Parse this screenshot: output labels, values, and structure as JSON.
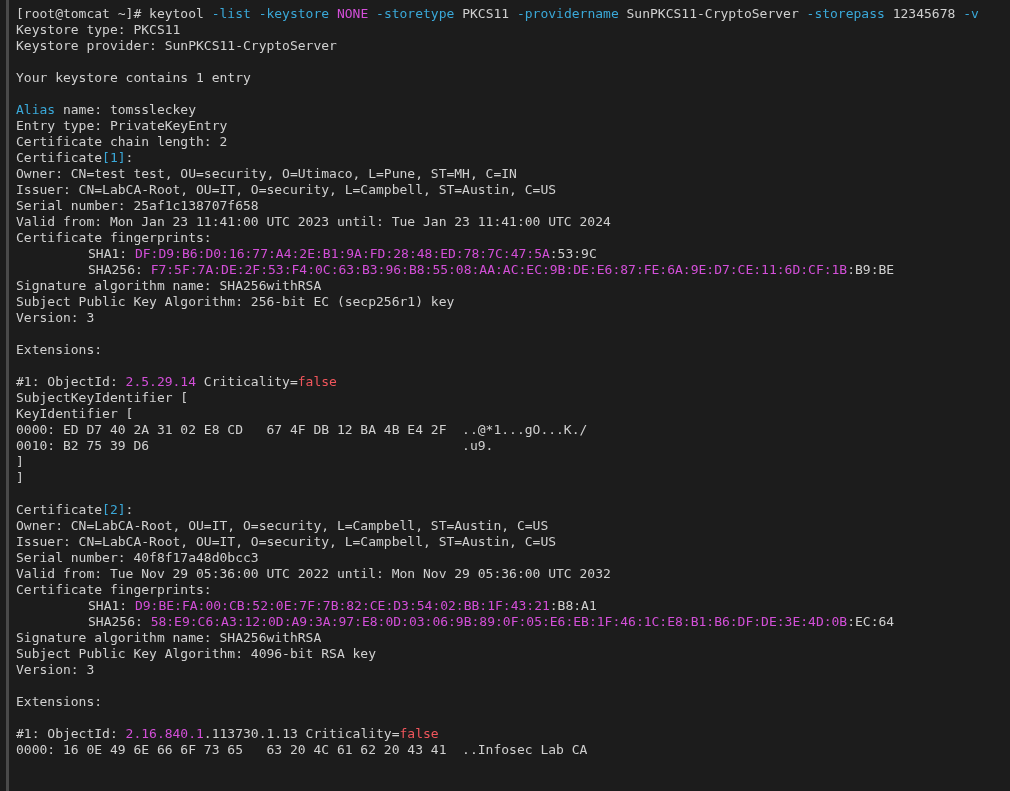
{
  "terminal": {
    "lines": [
      {
        "kind": "text",
        "segments": [
          {
            "kind": "plain",
            "text": "[root@tomcat ~]# keytool "
          },
          {
            "kind": "flag",
            "text": "-list "
          },
          {
            "kind": "flag",
            "text": "-keystore "
          },
          {
            "kind": "value",
            "text": "NONE "
          },
          {
            "kind": "flag",
            "text": "-storetype"
          },
          {
            "kind": "plain",
            "text": " PKCS11 "
          },
          {
            "kind": "flag",
            "text": "-providername"
          },
          {
            "kind": "plain",
            "text": " SunPKCS11-CryptoServer "
          },
          {
            "kind": "flag",
            "text": "-storepass"
          },
          {
            "kind": "plain",
            "text": " 12345678 "
          },
          {
            "kind": "flag",
            "text": "-v"
          }
        ]
      },
      {
        "kind": "text",
        "segments": [
          {
            "kind": "plain",
            "text": "Keystore type: PKCS11"
          }
        ]
      },
      {
        "kind": "text",
        "segments": [
          {
            "kind": "plain",
            "text": "Keystore provider: SunPKCS11-CryptoServer"
          }
        ]
      },
      {
        "kind": "blank"
      },
      {
        "kind": "text",
        "segments": [
          {
            "kind": "plain",
            "text": "Your keystore contains 1 entry"
          }
        ]
      },
      {
        "kind": "blank"
      },
      {
        "kind": "text",
        "segments": [
          {
            "kind": "flag",
            "text": "Alias"
          },
          {
            "kind": "plain",
            "text": " name: tomssleckey"
          }
        ]
      },
      {
        "kind": "text",
        "segments": [
          {
            "kind": "plain",
            "text": "Entry type: PrivateKeyEntry"
          }
        ]
      },
      {
        "kind": "text",
        "segments": [
          {
            "kind": "plain",
            "text": "Certificate chain length: 2"
          }
        ]
      },
      {
        "kind": "text",
        "segments": [
          {
            "kind": "plain",
            "text": "Certificate"
          },
          {
            "kind": "flag",
            "text": "[1]"
          },
          {
            "kind": "plain",
            "text": ":"
          }
        ]
      },
      {
        "kind": "text",
        "segments": [
          {
            "kind": "plain",
            "text": "Owner: CN=test test, OU=security, O=Utimaco, L=Pune, ST=MH, C=IN"
          }
        ]
      },
      {
        "kind": "text",
        "segments": [
          {
            "kind": "plain",
            "text": "Issuer: CN=LabCA-Root, OU=IT, O=security, L=Campbell, ST=Austin, C=US"
          }
        ]
      },
      {
        "kind": "text",
        "segments": [
          {
            "kind": "plain",
            "text": "Serial number: 25af1c138707f658"
          }
        ]
      },
      {
        "kind": "text",
        "segments": [
          {
            "kind": "plain",
            "text": "Valid from: Mon Jan 23 11:41:00 UTC 2023 until: Tue Jan 23 11:41:00 UTC 2024"
          }
        ]
      },
      {
        "kind": "text",
        "segments": [
          {
            "kind": "plain",
            "text": "Certificate fingerprints:"
          }
        ]
      },
      {
        "kind": "indented",
        "segments": [
          {
            "kind": "plain",
            "text": "SHA1: "
          },
          {
            "kind": "value",
            "text": "DF:D9:B6:D0:16:77:A4:2E:B1:9A:FD:28:48:ED:78:7C:47:5A"
          },
          {
            "kind": "plain",
            "text": ":53:9C"
          }
        ]
      },
      {
        "kind": "indented",
        "segments": [
          {
            "kind": "plain",
            "text": "SHA256: "
          },
          {
            "kind": "value",
            "text": "F7:5F:7A:DE:2F:53:F4:0C:63:B3:96:B8:55:08:AA:AC:EC:9B:DE:E6:87:FE:6A:9E:D7:CE:11:6D:CF:1B"
          },
          {
            "kind": "plain",
            "text": ":B9:BE"
          }
        ]
      },
      {
        "kind": "text",
        "segments": [
          {
            "kind": "plain",
            "text": "Signature algorithm name: SHA256withRSA"
          }
        ]
      },
      {
        "kind": "text",
        "segments": [
          {
            "kind": "plain",
            "text": "Subject Public Key Algorithm: 256-bit EC (secp256r1) key"
          }
        ]
      },
      {
        "kind": "text",
        "segments": [
          {
            "kind": "plain",
            "text": "Version: 3"
          }
        ]
      },
      {
        "kind": "blank"
      },
      {
        "kind": "text",
        "segments": [
          {
            "kind": "plain",
            "text": "Extensions:"
          }
        ]
      },
      {
        "kind": "blank"
      },
      {
        "kind": "text",
        "segments": [
          {
            "kind": "plain",
            "text": "#1: ObjectId: "
          },
          {
            "kind": "value",
            "text": "2.5.29.14"
          },
          {
            "kind": "plain",
            "text": " Criticality="
          },
          {
            "kind": "bool",
            "text": "false"
          }
        ]
      },
      {
        "kind": "text",
        "segments": [
          {
            "kind": "plain",
            "text": "SubjectKeyIdentifier ["
          }
        ]
      },
      {
        "kind": "text",
        "segments": [
          {
            "kind": "plain",
            "text": "KeyIdentifier ["
          }
        ]
      },
      {
        "kind": "text",
        "segments": [
          {
            "kind": "plain",
            "text": "0000: ED D7 40 2A 31 02 E8 CD   67 4F DB 12 BA 4B E4 2F  ..@*1...gO...K./"
          }
        ]
      },
      {
        "kind": "text",
        "segments": [
          {
            "kind": "plain",
            "text": "0010: B2 75 39 D6                                        .u9."
          }
        ]
      },
      {
        "kind": "text",
        "segments": [
          {
            "kind": "plain",
            "text": "]"
          }
        ]
      },
      {
        "kind": "text",
        "segments": [
          {
            "kind": "plain",
            "text": "]"
          }
        ]
      },
      {
        "kind": "blank"
      },
      {
        "kind": "text",
        "segments": [
          {
            "kind": "plain",
            "text": "Certificate"
          },
          {
            "kind": "flag",
            "text": "[2]"
          },
          {
            "kind": "plain",
            "text": ":"
          }
        ]
      },
      {
        "kind": "text",
        "segments": [
          {
            "kind": "plain",
            "text": "Owner: CN=LabCA-Root, OU=IT, O=security, L=Campbell, ST=Austin, C=US"
          }
        ]
      },
      {
        "kind": "text",
        "segments": [
          {
            "kind": "plain",
            "text": "Issuer: CN=LabCA-Root, OU=IT, O=security, L=Campbell, ST=Austin, C=US"
          }
        ]
      },
      {
        "kind": "text",
        "segments": [
          {
            "kind": "plain",
            "text": "Serial number: 40f8f17a48d0bcc3"
          }
        ]
      },
      {
        "kind": "text",
        "segments": [
          {
            "kind": "plain",
            "text": "Valid from: Tue Nov 29 05:36:00 UTC 2022 until: Mon Nov 29 05:36:00 UTC 2032"
          }
        ]
      },
      {
        "kind": "text",
        "segments": [
          {
            "kind": "plain",
            "text": "Certificate fingerprints:"
          }
        ]
      },
      {
        "kind": "indented",
        "segments": [
          {
            "kind": "plain",
            "text": "SHA1: "
          },
          {
            "kind": "value",
            "text": "D9:BE:FA:00:CB:52:0E:7F:7B:82:CE:D3:54:02:BB:1F:43:21"
          },
          {
            "kind": "plain",
            "text": ":B8:A1"
          }
        ]
      },
      {
        "kind": "indented",
        "segments": [
          {
            "kind": "plain",
            "text": "SHA256: "
          },
          {
            "kind": "value",
            "text": "58:E9:C6:A3:12:0D:A9:3A:97:E8:0D:03:06:9B:89:0F:05:E6:EB:1F:46:1C:E8:B1:B6:DF:DE:3E:4D:0B"
          },
          {
            "kind": "plain",
            "text": ":EC:64"
          }
        ]
      },
      {
        "kind": "text",
        "segments": [
          {
            "kind": "plain",
            "text": "Signature algorithm name: SHA256withRSA"
          }
        ]
      },
      {
        "kind": "text",
        "segments": [
          {
            "kind": "plain",
            "text": "Subject Public Key Algorithm: 4096-bit RSA key"
          }
        ]
      },
      {
        "kind": "text",
        "segments": [
          {
            "kind": "plain",
            "text": "Version: 3"
          }
        ]
      },
      {
        "kind": "blank"
      },
      {
        "kind": "text",
        "segments": [
          {
            "kind": "plain",
            "text": "Extensions:"
          }
        ]
      },
      {
        "kind": "blank"
      },
      {
        "kind": "text",
        "segments": [
          {
            "kind": "plain",
            "text": "#1: ObjectId: "
          },
          {
            "kind": "value",
            "text": "2.16.840.1"
          },
          {
            "kind": "plain",
            "text": ".113730.1.13 Criticality="
          },
          {
            "kind": "bool",
            "text": "false"
          }
        ]
      },
      {
        "kind": "text",
        "segments": [
          {
            "kind": "plain",
            "text": "0000: 16 0E 49 6E 66 6F 73 65   63 20 4C 61 62 20 43 41  ..Infosec Lab CA"
          }
        ]
      }
    ]
  }
}
